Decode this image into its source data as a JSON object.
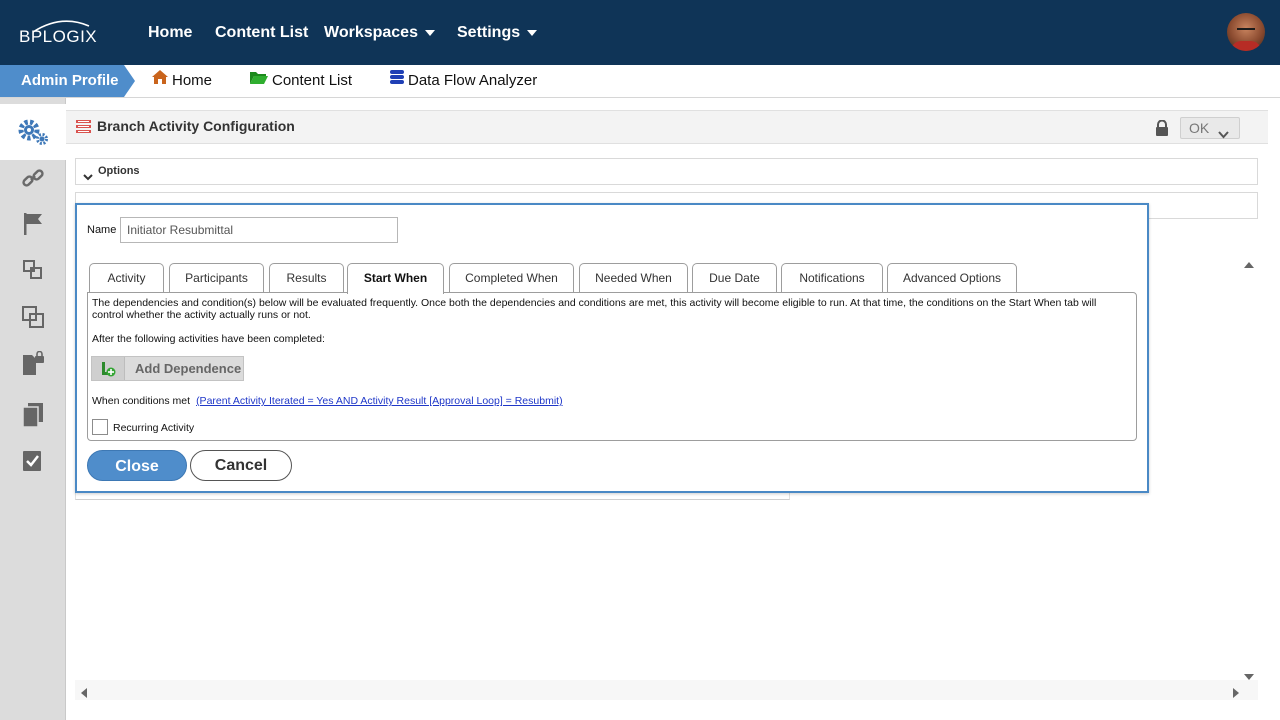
{
  "topbar": {
    "logo_text": "BPLOGIX",
    "nav": [
      {
        "label": "Home"
      },
      {
        "label": "Content List"
      },
      {
        "label": "Workspaces"
      },
      {
        "label": "Settings"
      }
    ]
  },
  "breadcrumb": {
    "active": "Admin Profile",
    "items": [
      {
        "label": "Home",
        "icon": "home-icon"
      },
      {
        "label": "Content List",
        "icon": "folder-icon"
      },
      {
        "label": "Data Flow Analyzer",
        "icon": "database-icon"
      }
    ]
  },
  "sidebar": {
    "items": [
      "gears-icon",
      "link-icon",
      "flag-icon",
      "nested-boxes-icon",
      "overlap-boxes-icon",
      "locked-document-icon",
      "copy-document-icon",
      "checked-document-icon"
    ]
  },
  "panel": {
    "title": "Branch Activity Configuration",
    "ok_label": "OK",
    "sections": [
      {
        "label": "Options"
      }
    ]
  },
  "dialog": {
    "name_label": "Name",
    "name_value": "Initiator Resubmittal",
    "tabs": [
      {
        "label": "Activity"
      },
      {
        "label": "Participants"
      },
      {
        "label": "Results"
      },
      {
        "label": "Start When",
        "active": true
      },
      {
        "label": "Completed When"
      },
      {
        "label": "Needed When"
      },
      {
        "label": "Due Date"
      },
      {
        "label": "Notifications"
      },
      {
        "label": "Advanced Options"
      }
    ],
    "description": "The dependencies and condition(s) below will be evaluated frequently. Once both the dependencies and conditions are met, this activity will become eligible to run. At that time, the conditions on the Start When tab will control whether the activity actually runs or not.",
    "after_label": "After the following activities have been completed:",
    "add_dependence_label": "Add Dependence",
    "when_label": "When conditions met",
    "when_condition": "(Parent Activity Iterated = Yes AND Activity Result [Approval Loop] = Resubmit)",
    "recurring_label": "Recurring Activity",
    "recurring_checked": false,
    "close_label": "Close",
    "cancel_label": "Cancel"
  },
  "colors": {
    "topbar": "#0f3457",
    "accent": "#4f8dcb",
    "link": "#1f37c8"
  }
}
